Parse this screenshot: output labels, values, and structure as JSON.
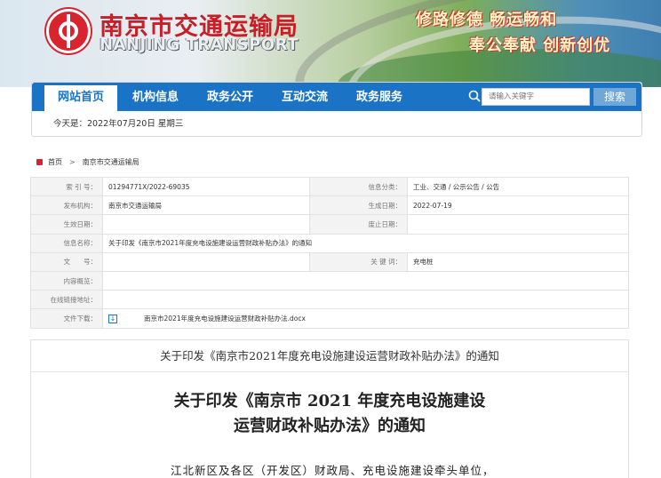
{
  "banner": {
    "logo_cn": "南京市交通运输局",
    "logo_en": "NANJING TRANSPORT",
    "slogan_line1": "修路修德  畅运畅和",
    "slogan_line2": "奉公奉献  创新创优"
  },
  "nav": {
    "items": [
      {
        "label": "网站首页",
        "active": true
      },
      {
        "label": "机构信息"
      },
      {
        "label": "政务公开"
      },
      {
        "label": "互动交流"
      },
      {
        "label": "政务服务"
      }
    ],
    "search": {
      "placeholder": "请输入关键字",
      "button_label": "搜索"
    },
    "date_text": "今天是：2022年07月20日 星期三"
  },
  "breadcrumb": {
    "home": "首页",
    "current": "南京市交通运输局"
  },
  "info_table": {
    "index_label": "索 引 号：",
    "index_value": "01294771X/2022-69035",
    "category_label": "信息分类：",
    "category_value": "工业、交通 / 公示公告 / 公告",
    "publisher_label": "发布机构：",
    "publisher_value": "南京市交通运输局",
    "created_label": "生成日期：",
    "created_value": "2022-07-19",
    "effective_label": "生效日期：",
    "effective_value": "",
    "abolish_label": "废止日期：",
    "abolish_value": "",
    "name_label": "信息名称：",
    "name_value": "关于印发《南京市2021年度充电设施建设运营财政补贴办法》的通知",
    "doc_no_label": "文　　号：",
    "doc_no_value": "",
    "keyword_label": "关 键 词：",
    "keyword_value": "充电桩",
    "overview_label": "内容概览：",
    "overview_value": "",
    "link_label": "在线链接地址：",
    "link_value": "",
    "download_label": "文件下载：",
    "download_value": "南京市2021年度充电设施建设运营财政补贴办法.docx"
  },
  "content": {
    "header_title": "关于印发《南京市2021年度充电设施建设运营财政补贴办法》的通知",
    "doc_title_line1": "关于印发《南京市 2021 年度充电设施建设",
    "doc_title_line2": "运营财政补贴办法》的通知",
    "salutation": "江北新区及各区（开发区）财政局、充电设施建设牵头单位，"
  },
  "colors": {
    "brand_red": "#d9232e",
    "nav_blue": "#1a73c4"
  }
}
